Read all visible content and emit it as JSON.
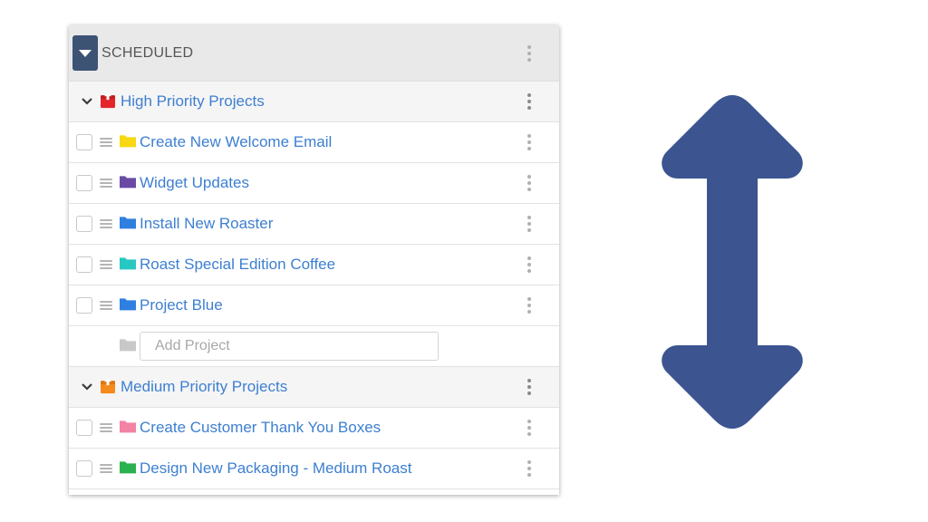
{
  "section": {
    "title": "SCHEDULED"
  },
  "groups": [
    {
      "label": "High Priority Projects",
      "icon_color": "#e2262a",
      "items": [
        {
          "label": "Create New Welcome Email",
          "folder_color": "#f7d812"
        },
        {
          "label": "Widget Updates",
          "folder_color": "#6b4aa6"
        },
        {
          "label": "Install New Roaster",
          "folder_color": "#2f7fe0"
        },
        {
          "label": "Roast Special Edition Coffee",
          "folder_color": "#28c7c2"
        },
        {
          "label": "Project Blue",
          "folder_color": "#2f7fe0"
        }
      ],
      "add_placeholder": "Add Project"
    },
    {
      "label": "Medium Priority Projects",
      "icon_color": "#f48a1c",
      "items": [
        {
          "label": "Create Customer Thank You Boxes",
          "folder_color": "#f283a4"
        },
        {
          "label": "Design New Packaging - Medium Roast",
          "folder_color": "#2bb14f"
        }
      ]
    }
  ],
  "colors": {
    "accent": "#3d7fd1",
    "header_button": "#3c5374",
    "arrow": "#3c5490"
  },
  "icons": {
    "collapse": "caret-down-icon",
    "group_toggle": "chevron-down-icon",
    "group": "box-icon",
    "menu": "kebab-menu-icon",
    "drag": "drag-handle-icon",
    "folder": "folder-icon",
    "arrow": "vertical-double-arrow-icon"
  }
}
